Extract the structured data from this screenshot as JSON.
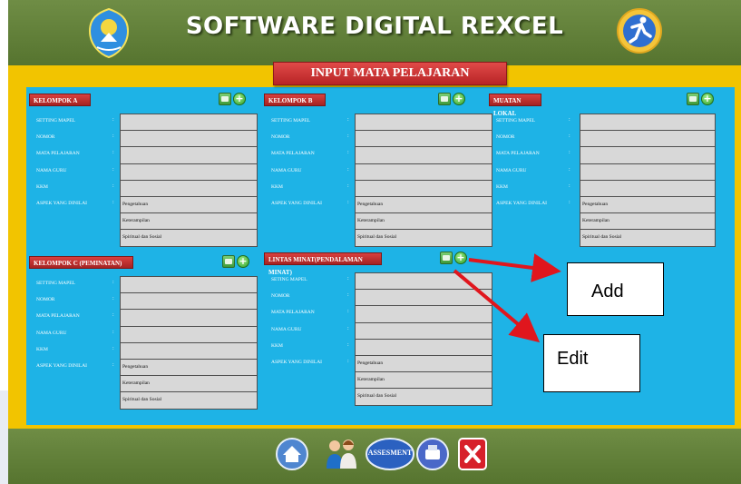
{
  "app": {
    "title": "SOFTWARE DIGITAL REXCEL",
    "screen_banner": "INPUT MATA PELAJARAN",
    "brand_color": "#5c7a3a",
    "frame_color": "#f2c400",
    "canvas_color": "#1eb3e6"
  },
  "panels": [
    {
      "title": "KELOMPOK A",
      "rows": [
        {
          "label": "SETTING MAPEL",
          "value": ""
        },
        {
          "label": "NOMOR",
          "value": ""
        },
        {
          "label": "MATA PELAJARAN",
          "value": ""
        },
        {
          "label": "NAMA GURU",
          "value": ""
        },
        {
          "label": "KKM",
          "value": ""
        },
        {
          "label": "ASPEK YANG DINILAI",
          "value": "Pengetahuan"
        }
      ],
      "extra": [
        "Keterampilan",
        "Spiritual dan Sosial"
      ]
    },
    {
      "title": "KELOMPOK B",
      "rows": [
        {
          "label": "SETTING MAPEL",
          "value": ""
        },
        {
          "label": "NOMOR",
          "value": ""
        },
        {
          "label": "MATA PELAJARAN",
          "value": ""
        },
        {
          "label": "NAMA GURU",
          "value": ""
        },
        {
          "label": "KKM",
          "value": ""
        },
        {
          "label": "ASPEK YANG DINILAI",
          "value": "Pengetahuan"
        }
      ],
      "extra": [
        "Keterampilan",
        "Spiritual dan Sosial"
      ]
    },
    {
      "title": "MUATAN LOKAL",
      "rows": [
        {
          "label": "SETTING MAPEL",
          "value": ""
        },
        {
          "label": "NOMOR",
          "value": ""
        },
        {
          "label": "MATA PELAJARAN",
          "value": ""
        },
        {
          "label": "NAMA GURU",
          "value": ""
        },
        {
          "label": "KKM",
          "value": ""
        },
        {
          "label": "ASPEK YANG DINILAI",
          "value": "Pengetahuan"
        }
      ],
      "extra": [
        "Keterampilan",
        "Spiritual dan Sosial"
      ]
    },
    {
      "title": "KELOMPOK C (PEMINATAN)",
      "rows": [
        {
          "label": "SETTING MAPEL",
          "value": ""
        },
        {
          "label": "NOMOR",
          "value": ""
        },
        {
          "label": "MATA PELAJARAN",
          "value": ""
        },
        {
          "label": "NAMA GURU",
          "value": ""
        },
        {
          "label": "KKM",
          "value": ""
        },
        {
          "label": "ASPEK YANG DINILAI",
          "value": "Pengetahuan"
        }
      ],
      "extra": [
        "Keterampilan",
        "Spiritual dan Sosial"
      ]
    },
    {
      "title": "LINTAS MINAT(PENDALAMAN MINAT)",
      "rows": [
        {
          "label": "SETING MAPEL",
          "value": ""
        },
        {
          "label": "NOMOR",
          "value": ""
        },
        {
          "label": "MATA PELAJARAN",
          "value": ""
        },
        {
          "label": "NAMA GURU",
          "value": ""
        },
        {
          "label": "KKM",
          "value": ""
        },
        {
          "label": "ASPEK YANG DINILAI",
          "value": "Pengetahuan"
        }
      ],
      "extra": [
        "Keterampilan",
        "Spiritual dan Sosial"
      ]
    }
  ],
  "annotations": {
    "add_label": "Add",
    "edit_label": "Edit",
    "arrow_color": "#e0161d"
  },
  "footer": {
    "assessment_label": "ASSESMENT",
    "buttons": [
      "home-icon",
      "users-icon",
      "assessment-button",
      "print-icon",
      "close-icon"
    ]
  }
}
